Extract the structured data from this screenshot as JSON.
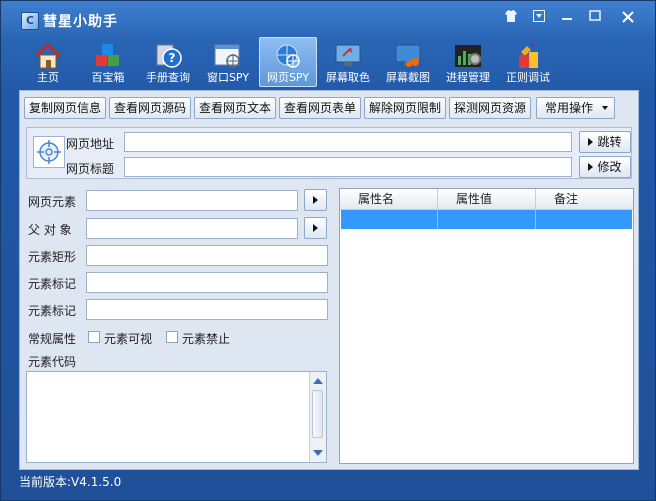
{
  "window": {
    "title": "彗星小助手"
  },
  "toolbar": {
    "items": [
      {
        "label": "主页",
        "icon": "house-icon"
      },
      {
        "label": "百宝箱",
        "icon": "cubes-icon"
      },
      {
        "label": "手册查询",
        "icon": "help-icon"
      },
      {
        "label": "窗口SPY",
        "icon": "window-spy-icon"
      },
      {
        "label": "网页SPY",
        "icon": "web-spy-icon",
        "active": true
      },
      {
        "label": "屏幕取色",
        "icon": "color-picker-icon"
      },
      {
        "label": "屏幕截图",
        "icon": "screenshot-icon"
      },
      {
        "label": "进程管理",
        "icon": "process-icon"
      },
      {
        "label": "正则调试",
        "icon": "regex-icon"
      }
    ]
  },
  "actions": {
    "copy_info": "复制网页信息",
    "view_source": "查看网页源码",
    "view_text": "查看网页文本",
    "view_forms": "查看网页表单",
    "remove_limit": "解除网页限制",
    "probe_resources": "探测网页资源",
    "common_ops": "常用操作"
  },
  "url": {
    "address_label": "网页地址",
    "address_value": "",
    "title_label": "网页标题",
    "title_value": "",
    "jump_label": "跳转",
    "edit_label": "修改"
  },
  "element": {
    "element_label": "网页元素",
    "parent_label": "父 对 象",
    "rect_label": "元素矩形",
    "mark_label_1": "元素标记",
    "mark_label_2": "元素标记",
    "props_label": "常规属性",
    "visible_label": "元素可视",
    "disabled_label": "元素禁止",
    "code_label": "元素代码"
  },
  "table": {
    "headers": [
      "属性名",
      "属性值",
      "备注"
    ]
  },
  "status": {
    "version": "当前版本:V4.1.5.0"
  },
  "colors": {
    "accent": "#2a65b5",
    "selection": "#3399ff"
  }
}
